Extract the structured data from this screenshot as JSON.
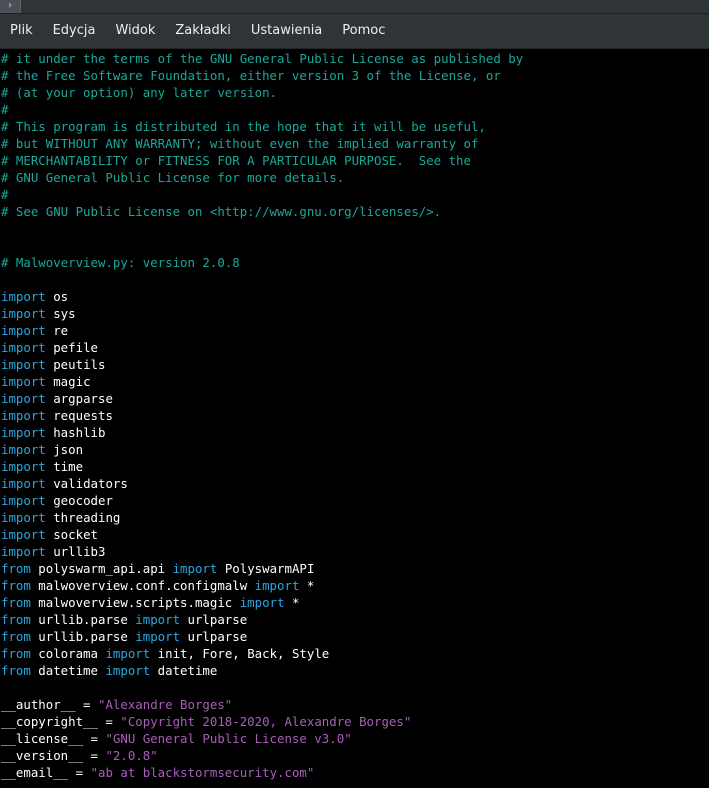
{
  "window": {
    "title_button_glyph": "›"
  },
  "menubar": {
    "items": [
      "Plik",
      "Edycja",
      "Widok",
      "Zakładki",
      "Ustawienia",
      "Pomoc"
    ]
  },
  "colors": {
    "comment": "#19a89a",
    "keyword": "#2aa6e0",
    "string": "#a75fb6",
    "text": "#ffffff",
    "background": "#000000"
  },
  "editor": {
    "lines": [
      [
        [
          "c",
          "# it under the terms of the GNU General Public License as published by"
        ]
      ],
      [
        [
          "c",
          "# the Free Software Foundation, either version 3 of the License, or"
        ]
      ],
      [
        [
          "c",
          "# (at your option) any later version."
        ]
      ],
      [
        [
          "c",
          "#"
        ]
      ],
      [
        [
          "c",
          "# This program is distributed in the hope that it will be useful,"
        ]
      ],
      [
        [
          "c",
          "# but WITHOUT ANY WARRANTY; without even the implied warranty of"
        ]
      ],
      [
        [
          "c",
          "# MERCHANTABILITY or FITNESS FOR A PARTICULAR PURPOSE.  See the"
        ]
      ],
      [
        [
          "c",
          "# GNU General Public License for more details."
        ]
      ],
      [
        [
          "c",
          "#"
        ]
      ],
      [
        [
          "c",
          "# See GNU Public License on <http://www.gnu.org/licenses/>."
        ]
      ],
      [],
      [],
      [
        [
          "c",
          "# Malwoverview.py: version 2.0.8"
        ]
      ],
      [],
      [
        [
          "k",
          "import"
        ],
        [
          "t",
          " os"
        ]
      ],
      [
        [
          "k",
          "import"
        ],
        [
          "t",
          " sys"
        ]
      ],
      [
        [
          "k",
          "import"
        ],
        [
          "t",
          " re"
        ]
      ],
      [
        [
          "k",
          "import"
        ],
        [
          "t",
          " pefile"
        ]
      ],
      [
        [
          "k",
          "import"
        ],
        [
          "t",
          " peutils"
        ]
      ],
      [
        [
          "k",
          "import"
        ],
        [
          "t",
          " magic"
        ]
      ],
      [
        [
          "k",
          "import"
        ],
        [
          "t",
          " argparse"
        ]
      ],
      [
        [
          "k",
          "import"
        ],
        [
          "t",
          " requests"
        ]
      ],
      [
        [
          "k",
          "import"
        ],
        [
          "t",
          " hashlib"
        ]
      ],
      [
        [
          "k",
          "import"
        ],
        [
          "t",
          " json"
        ]
      ],
      [
        [
          "k",
          "import"
        ],
        [
          "t",
          " time"
        ]
      ],
      [
        [
          "k",
          "import"
        ],
        [
          "t",
          " validators"
        ]
      ],
      [
        [
          "k",
          "import"
        ],
        [
          "t",
          " geocoder"
        ]
      ],
      [
        [
          "k",
          "import"
        ],
        [
          "t",
          " threading"
        ]
      ],
      [
        [
          "k",
          "import"
        ],
        [
          "t",
          " socket"
        ]
      ],
      [
        [
          "k",
          "import"
        ],
        [
          "t",
          " urllib3"
        ]
      ],
      [
        [
          "k",
          "from"
        ],
        [
          "t",
          " polyswarm_api.api "
        ],
        [
          "k",
          "import"
        ],
        [
          "t",
          " PolyswarmAPI"
        ]
      ],
      [
        [
          "k",
          "from"
        ],
        [
          "t",
          " malwoverview.conf.configmalw "
        ],
        [
          "k",
          "import"
        ],
        [
          "t",
          " *"
        ]
      ],
      [
        [
          "k",
          "from"
        ],
        [
          "t",
          " malwoverview.scripts.magic "
        ],
        [
          "k",
          "import"
        ],
        [
          "t",
          " *"
        ]
      ],
      [
        [
          "k",
          "from"
        ],
        [
          "t",
          " urllib.parse "
        ],
        [
          "k",
          "import"
        ],
        [
          "t",
          " urlparse"
        ]
      ],
      [
        [
          "k",
          "from"
        ],
        [
          "t",
          " urllib.parse "
        ],
        [
          "k",
          "import"
        ],
        [
          "t",
          " urlparse"
        ]
      ],
      [
        [
          "k",
          "from"
        ],
        [
          "t",
          " colorama "
        ],
        [
          "k",
          "import"
        ],
        [
          "t",
          " init, Fore, Back, Style"
        ]
      ],
      [
        [
          "k",
          "from"
        ],
        [
          "t",
          " datetime "
        ],
        [
          "k",
          "import"
        ],
        [
          "t",
          " datetime"
        ]
      ],
      [],
      [
        [
          "t",
          "__author__ = "
        ],
        [
          "s",
          "\"Alexandre Borges\""
        ]
      ],
      [
        [
          "t",
          "__copyright__ = "
        ],
        [
          "s",
          "\"Copyright 2018-2020, Alexandre Borges\""
        ]
      ],
      [
        [
          "t",
          "__license__ = "
        ],
        [
          "s",
          "\"GNU General Public License v3.0\""
        ]
      ],
      [
        [
          "t",
          "__version__ = "
        ],
        [
          "s",
          "\"2.0.8\""
        ]
      ],
      [
        [
          "t",
          "__email__ = "
        ],
        [
          "s",
          "\"ab at blackstormsecurity.com\""
        ]
      ]
    ]
  }
}
